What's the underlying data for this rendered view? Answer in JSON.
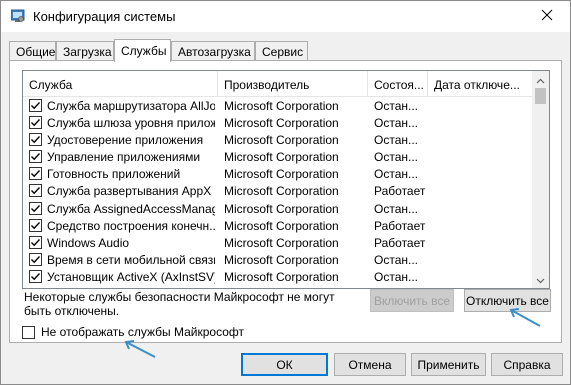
{
  "window": {
    "title": "Конфигурация системы",
    "close_glyph": "✕"
  },
  "tabs": [
    {
      "label": "Общие",
      "active": false
    },
    {
      "label": "Загрузка",
      "active": false
    },
    {
      "label": "Службы",
      "active": true
    },
    {
      "label": "Автозагрузка",
      "active": false
    },
    {
      "label": "Сервис",
      "active": false
    }
  ],
  "services_table": {
    "columns": [
      "Служба",
      "Производитель",
      "Состоя...",
      "Дата отключе..."
    ],
    "rows": [
      {
        "name": "Служба маршрутизатора AllJoyn",
        "vendor": "Microsoft Corporation",
        "status": "Остан...",
        "date": "",
        "checked": true
      },
      {
        "name": "Служба шлюза уровня прилож...",
        "vendor": "Microsoft Corporation",
        "status": "Остан...",
        "date": "",
        "checked": true
      },
      {
        "name": "Удостоверение приложения",
        "vendor": "Microsoft Corporation",
        "status": "Остан...",
        "date": "",
        "checked": true
      },
      {
        "name": "Управление приложениями",
        "vendor": "Microsoft Corporation",
        "status": "Остан...",
        "date": "",
        "checked": true
      },
      {
        "name": "Готовность приложений",
        "vendor": "Microsoft Corporation",
        "status": "Остан...",
        "date": "",
        "checked": true
      },
      {
        "name": "Служба развертывания AppX (...",
        "vendor": "Microsoft Corporation",
        "status": "Работает",
        "date": "",
        "checked": true
      },
      {
        "name": "Служба AssignedAccessManager",
        "vendor": "Microsoft Corporation",
        "status": "Остан...",
        "date": "",
        "checked": true
      },
      {
        "name": "Средство построения конечн...",
        "vendor": "Microsoft Corporation",
        "status": "Работает",
        "date": "",
        "checked": true
      },
      {
        "name": "Windows Audio",
        "vendor": "Microsoft Corporation",
        "status": "Работает",
        "date": "",
        "checked": true
      },
      {
        "name": "Время в сети мобильной связи",
        "vendor": "Microsoft Corporation",
        "status": "Остан...",
        "date": "",
        "checked": true
      },
      {
        "name": "Установщик ActiveX (AxInstSV)",
        "vendor": "Microsoft Corporation",
        "status": "Остан...",
        "date": "",
        "checked": true
      }
    ]
  },
  "note_text": "Некоторые службы безопасности Майкрософт не могут быть отключены.",
  "buttons": {
    "enable_all": "Включить все",
    "disable_all": "Отключить все",
    "ok": "ОК",
    "cancel": "Отмена",
    "apply": "Применить",
    "help": "Справка"
  },
  "hide_ms_checkbox": {
    "label": "Не отображать службы Майкрософт",
    "checked": false
  },
  "colors": {
    "annotation_arrow": "#3a8fc6",
    "default_button_border": "#0078d7",
    "window_bg": "#f0f0f0"
  }
}
